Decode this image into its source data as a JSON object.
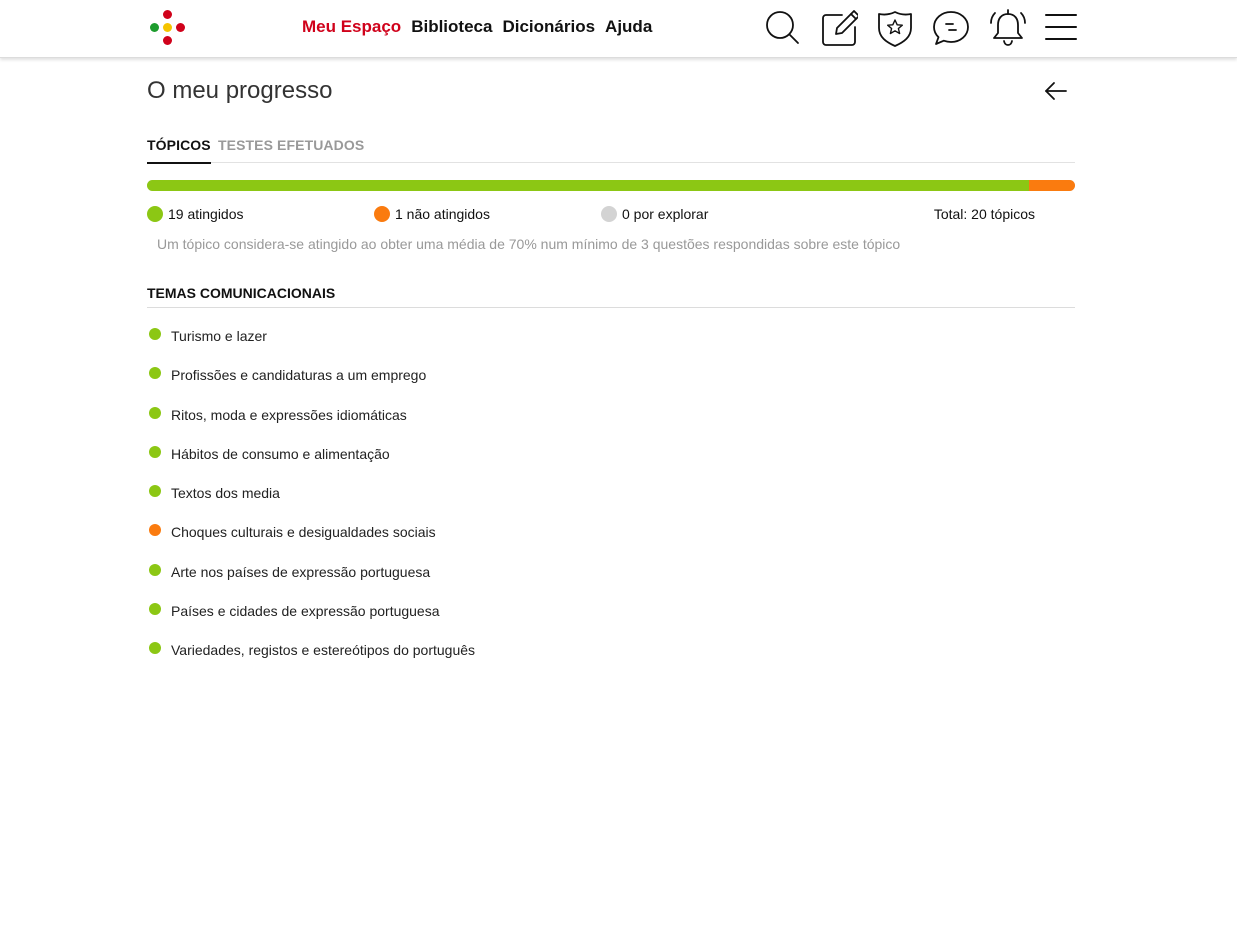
{
  "colors": {
    "accent_red": "#d0021b",
    "achieved": "#8cc714",
    "not_achieved": "#fa7b0f",
    "unexplored": "#d3d3d3",
    "logo": [
      "#d0021b",
      "#1d9c2d",
      "#f5c400"
    ]
  },
  "nav": {
    "items": [
      {
        "label": "Meu Espaço",
        "active": true
      },
      {
        "label": "Biblioteca",
        "active": false
      },
      {
        "label": "Dicionários",
        "active": false
      },
      {
        "label": "Ajuda",
        "active": false
      }
    ]
  },
  "toolbar_icons": [
    "search-icon",
    "edit-icon",
    "favorites-icon",
    "chat-icon",
    "notifications-icon",
    "menu-icon"
  ],
  "page": {
    "title": "O meu progresso",
    "back_icon": "arrow-left-icon"
  },
  "tabs": [
    {
      "label": "TÓPICOS",
      "active": true
    },
    {
      "label": "TESTES EFETUADOS",
      "active": false
    }
  ],
  "progress": {
    "achieved": 19,
    "not_achieved": 1,
    "unexplored": 0,
    "total": 20
  },
  "legend": {
    "achieved_label": "19 atingidos",
    "not_achieved_label": "1 não atingidos",
    "unexplored_label": "0 por explorar",
    "total_label": "Total: 20 tópicos"
  },
  "note": "Um tópico considera-se atingido ao obter uma média de 70% num mínimo de 3 questões respondidas sobre este tópico",
  "section": {
    "title": "TEMAS COMUNICACIONAIS",
    "topics": [
      {
        "label": "Turismo e lazer",
        "status": "achieved"
      },
      {
        "label": "Profissões e candidaturas a um emprego",
        "status": "achieved"
      },
      {
        "label": "Ritos, moda e expressões idiomáticas",
        "status": "achieved"
      },
      {
        "label": "Hábitos de consumo e alimentação",
        "status": "achieved"
      },
      {
        "label": "Textos dos media",
        "status": "achieved"
      },
      {
        "label": "Choques culturais e desigualdades sociais",
        "status": "not_achieved"
      },
      {
        "label": "Arte nos países de expressão portuguesa",
        "status": "achieved"
      },
      {
        "label": "Países e cidades de expressão portuguesa",
        "status": "achieved"
      },
      {
        "label": "Variedades, registos e estereótipos do português",
        "status": "achieved"
      }
    ]
  }
}
